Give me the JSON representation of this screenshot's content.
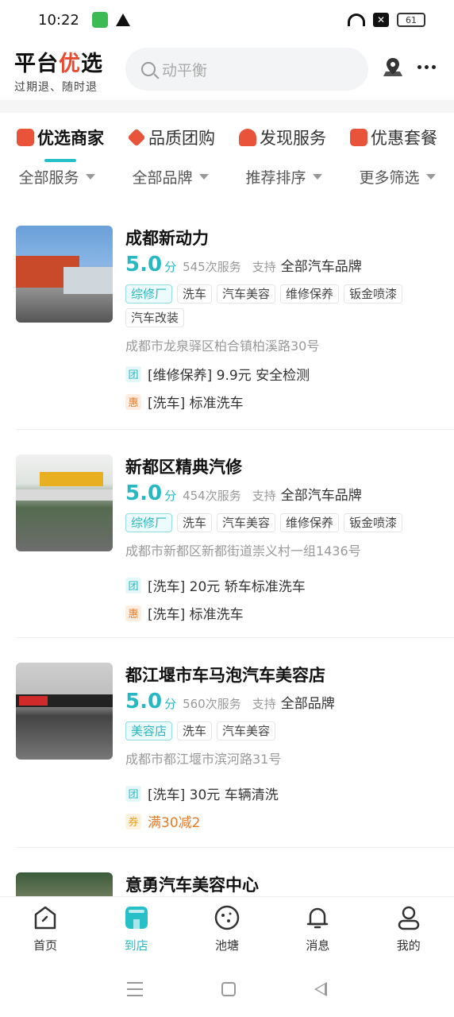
{
  "status_bar": {
    "time": "10:22",
    "battery": "61"
  },
  "header": {
    "brand_name_part1": "平台",
    "brand_name_accent": "优",
    "brand_name_part2": "选",
    "slogan": "过期退、随时退",
    "search_placeholder": "动平衡"
  },
  "category_tabs": [
    {
      "label": "优选商家",
      "icon": "store-icon",
      "color": "#e8533a",
      "active": true
    },
    {
      "label": "品质团购",
      "icon": "diamond-icon",
      "color": "#e8533a",
      "active": false
    },
    {
      "label": "发现服务",
      "icon": "hands-heart-icon",
      "color": "#e8533a",
      "active": false
    },
    {
      "label": "优惠套餐",
      "icon": "coupon-icon",
      "color": "#e8533a",
      "active": false
    }
  ],
  "filters": [
    "全部服务",
    "全部品牌",
    "推荐排序",
    "更多筛选"
  ],
  "shops": [
    {
      "name": "成都新动力",
      "score": "5.0",
      "score_unit": "分",
      "services": "545次服务",
      "support_label": "支持",
      "brands": "全部汽车品牌",
      "main_tag": "综修厂",
      "tags": [
        "洗车",
        "汽车美容",
        "维修保养",
        "钣金喷漆",
        "汽车改装"
      ],
      "address": "成都市龙泉驿区柏合镇柏溪路30号",
      "deals": [
        {
          "badge": "团",
          "type": "tuan",
          "text": "[维修保养] 9.9元 安全检测"
        },
        {
          "badge": "惠",
          "type": "hui",
          "text": "[洗车] 标准洗车"
        }
      ]
    },
    {
      "name": "新都区精典汽修",
      "score": "5.0",
      "score_unit": "分",
      "services": "454次服务",
      "support_label": "支持",
      "brands": "全部汽车品牌",
      "main_tag": "综修厂",
      "tags": [
        "洗车",
        "汽车美容",
        "维修保养",
        "钣金喷漆"
      ],
      "address": "成都市新都区新都街道崇义村一组1436号",
      "deals": [
        {
          "badge": "团",
          "type": "tuan",
          "text": "[洗车] 20元 轿车标准洗车"
        },
        {
          "badge": "惠",
          "type": "hui",
          "text": "[洗车] 标准洗车"
        }
      ]
    },
    {
      "name": "都江堰市车马泡汽车美容店",
      "score": "5.0",
      "score_unit": "分",
      "services": "560次服务",
      "support_label": "支持",
      "brands": "全部品牌",
      "main_tag": "美容店",
      "tags": [
        "洗车",
        "汽车美容"
      ],
      "address": "成都市都江堰市滨河路31号",
      "deals": [
        {
          "badge": "团",
          "type": "tuan",
          "text": "[洗车] 30元 车辆清洗"
        },
        {
          "badge": "券",
          "type": "quan",
          "text": "满30减2"
        }
      ]
    },
    {
      "name": "意勇汽车美容中心"
    }
  ],
  "bottom_tabs": [
    {
      "label": "首页",
      "icon": "home-icon",
      "active": false
    },
    {
      "label": "到店",
      "icon": "shop-icon",
      "active": true
    },
    {
      "label": "池塘",
      "icon": "pond-icon",
      "active": false
    },
    {
      "label": "消息",
      "icon": "bell-icon",
      "active": false
    },
    {
      "label": "我的",
      "icon": "profile-icon",
      "active": false
    }
  ],
  "colors": {
    "accent": "#28b8c2",
    "brand_red": "#e84a2f",
    "orange": "#e67a26"
  }
}
